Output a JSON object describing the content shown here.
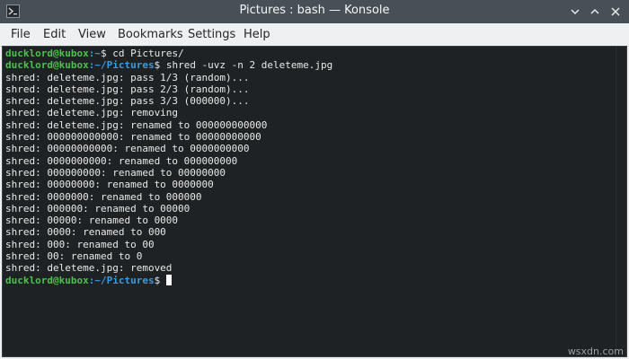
{
  "window": {
    "title": "Pictures : bash — Konsole",
    "minimize_glyph": "⌄",
    "maximize_glyph": "⌃",
    "close_glyph": "✕"
  },
  "menu": [
    "File",
    "Edit",
    "View",
    "Bookmarks",
    "Settings",
    "Help"
  ],
  "terminal": {
    "prompt_user": "ducklord@kubox",
    "cmd1_path": ":~",
    "cmd1_dollar": "$",
    "cmd1_command": " cd Pictures/",
    "cmd2_path": ":~/Pictures",
    "cmd2_dollar": "$",
    "cmd2_command": " shred -uvz -n 2 deleteme.jpg",
    "output": [
      "shred: deleteme.jpg: pass 1/3 (random)...",
      "shred: deleteme.jpg: pass 2/3 (random)...",
      "shred: deleteme.jpg: pass 3/3 (000000)...",
      "shred: deleteme.jpg: removing",
      "shred: deleteme.jpg: renamed to 000000000000",
      "shred: 000000000000: renamed to 00000000000",
      "shred: 00000000000: renamed to 0000000000",
      "shred: 0000000000: renamed to 000000000",
      "shred: 000000000: renamed to 00000000",
      "shred: 00000000: renamed to 0000000",
      "shred: 0000000: renamed to 000000",
      "shred: 000000: renamed to 00000",
      "shred: 00000: renamed to 0000",
      "shred: 0000: renamed to 000",
      "shred: 000: renamed to 00",
      "shred: 00: renamed to 0",
      "shred: deleteme.jpg: removed"
    ],
    "final_path": ":~/Pictures",
    "final_dollar": "$"
  },
  "watermark": "wsxdn.com",
  "icons": {
    "app": "konsole-terminal-icon",
    "minimize": "chevron-down-icon",
    "maximize": "chevron-up-icon",
    "close": "close-icon"
  }
}
